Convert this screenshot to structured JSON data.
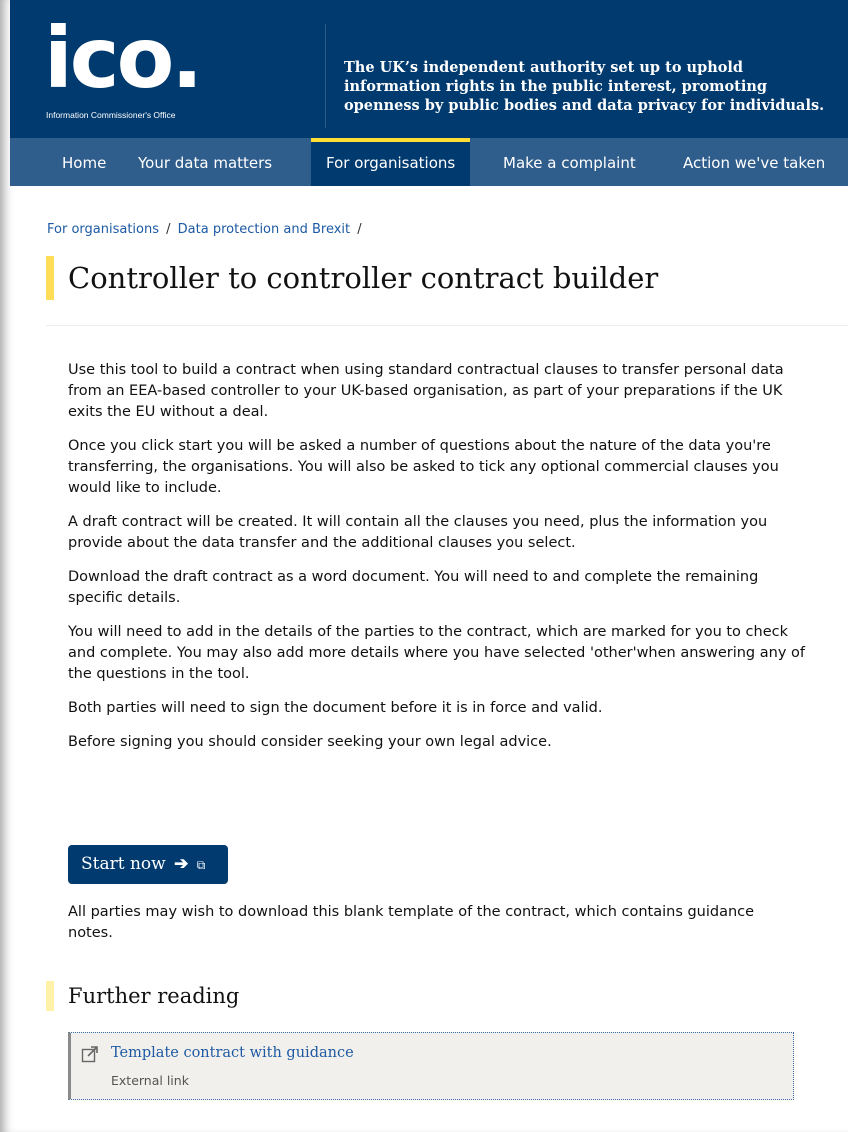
{
  "header": {
    "logo_text": "ico.",
    "logo_subtitle": "Information Commissioner's Office",
    "tagline": "The UK’s independent authority set up to uphold information rights in the public interest, promoting openness by public bodies and data privacy for individuals."
  },
  "nav": {
    "items": [
      {
        "label": "Home"
      },
      {
        "label": "Your data matters"
      },
      {
        "label": "For organisations"
      },
      {
        "label": "Make a complaint"
      },
      {
        "label": "Action we've taken"
      }
    ],
    "active": "For organisations"
  },
  "breadcrumb": {
    "items": [
      "For organisations",
      "Data protection and Brexit"
    ],
    "separator": "/"
  },
  "page": {
    "title": "Controller to controller contract builder",
    "paragraphs": [
      "Use this tool to build a contract when using standard contractual clauses to transfer personal data from an EEA-based controller to your UK-based organisation, as part of your preparations if the UK exits the EU without a deal.",
      "Once you click start you will be asked a number of questions about the nature of the data you're transferring, the organisations. You will also be asked to tick any optional commercial clauses you would like to include.",
      "A draft contract will be created. It will contain all the clauses you need, plus the information you provide about the data transfer and the additional clauses you select.",
      "Download the draft contract as a word document. You will need to and complete the remaining specific details.",
      "You will need to add in the details of the parties to the contract, which are marked for you to check and complete. You may also add more details where you have selected 'other'when answering any of the questions in the tool.",
      "Both parties will need to sign the document before it is in force and valid.",
      "Before signing you should consider seeking your own legal advice."
    ],
    "start_button": {
      "label": "Start now",
      "arrow": "➔",
      "external_icon": "⧉"
    },
    "template_note": " All parties may wish to download this blank template of the contract, which contains guidance notes."
  },
  "further_reading": {
    "title": "Further reading",
    "link_label": "Template contract with guidance",
    "link_sub": "External link",
    "icon": "external-link-icon"
  },
  "colors": {
    "header_bg": "#003a6e",
    "nav_bg": "#2f5d8c",
    "accent_yellow": "#ffdd33",
    "link": "#1d5aa3"
  }
}
